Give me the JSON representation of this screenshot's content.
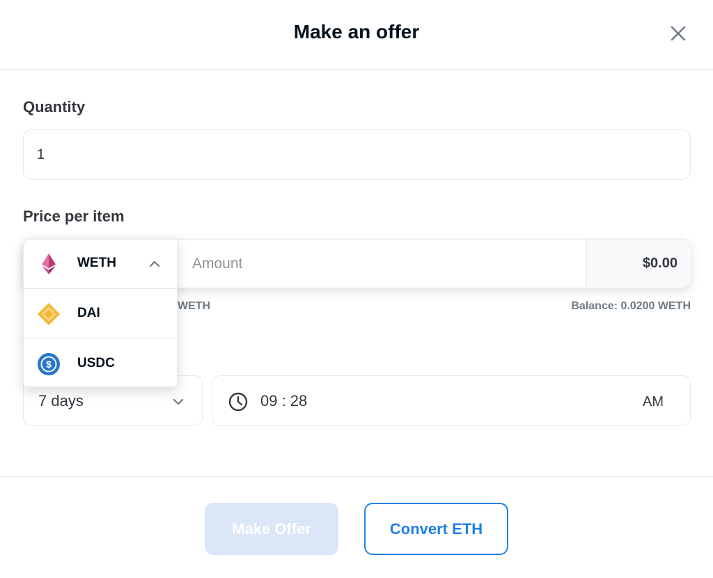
{
  "modal": {
    "title": "Make an offer",
    "close_icon": "close-icon"
  },
  "quantity": {
    "label": "Quantity",
    "value": "1"
  },
  "price": {
    "label": "Price per item",
    "selected_token": "WETH",
    "amount_placeholder": "Amount",
    "usd_value": "$0.00",
    "hint_fragment": "WETH",
    "balance": "Balance: 0.0200 WETH"
  },
  "token_dropdown": {
    "open": true,
    "options": [
      {
        "symbol": "WETH",
        "icon": "weth-icon",
        "color": "#c64b8c"
      },
      {
        "symbol": "DAI",
        "icon": "dai-icon",
        "color": "#f4b731"
      },
      {
        "symbol": "USDC",
        "icon": "usdc-icon",
        "color": "#2775ca"
      }
    ]
  },
  "expiration": {
    "duration": "7 days",
    "time": "09 : 28",
    "meridiem": "AM"
  },
  "footer": {
    "make_offer_label": "Make Offer",
    "make_offer_disabled": true,
    "convert_label": "Convert ETH"
  },
  "colors": {
    "accent": "#2081e2",
    "disabled_button": "#dbe6f8",
    "text_dark": "#04111d",
    "text_muted": "#707a83",
    "border": "#e5e8eb"
  }
}
